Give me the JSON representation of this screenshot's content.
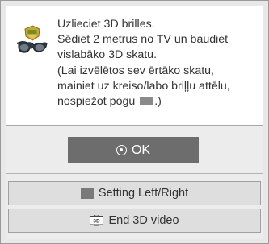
{
  "message": {
    "lines": [
      "Uzlieciet 3D brilles.",
      "Sēdiet 2 metrus no TV un baudiet",
      "vislabāko 3D skatu.",
      "(Lai izvēlētos sev ērtāko skatu,",
      "mainiet uz kreiso/labo briļļu attēlu,"
    ],
    "last_line_before": "nospiežot pogu",
    "last_line_after": ".)",
    "icon": "3d-glasses-icon"
  },
  "buttons": {
    "ok_label": "OK",
    "setting_label": "Setting Left/Right",
    "end_label": "End 3D video",
    "end_icon_text": "3D"
  },
  "colors": {
    "ok_background": "#6d6d6d",
    "panel_background": "#e8e8e8",
    "option_background": "#dedede"
  }
}
